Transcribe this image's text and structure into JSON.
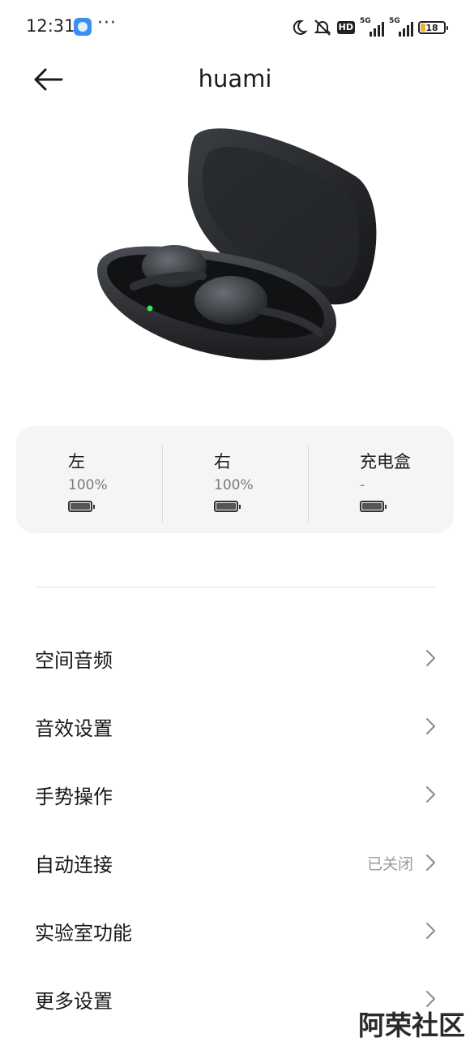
{
  "status_bar": {
    "time": "12:31",
    "more": "···",
    "hd_label": "HD",
    "network_1": "5G",
    "network_2": "5G",
    "battery_level": "18",
    "battery_color": "#f0b23a",
    "icons": [
      "app-icon",
      "moon-icon",
      "mute-bell-icon",
      "signal-icon",
      "battery-icon"
    ]
  },
  "header": {
    "title": "huami",
    "back_icon": "arrow-left-icon"
  },
  "product_image": "earbuds-charging-case",
  "battery_card": {
    "left": {
      "name": "左",
      "percent": "100%"
    },
    "right": {
      "name": "右",
      "percent": "100%"
    },
    "case": {
      "name": "充电盒",
      "percent": "-"
    }
  },
  "menu": {
    "items": [
      {
        "label": "空间音频",
        "value": ""
      },
      {
        "label": "音效设置",
        "value": ""
      },
      {
        "label": "手势操作",
        "value": ""
      },
      {
        "label": "自动连接",
        "value": "已关闭"
      },
      {
        "label": "实验室功能",
        "value": ""
      },
      {
        "label": "更多设置",
        "value": ""
      }
    ],
    "chevron_icon": "chevron-right-icon"
  },
  "watermark": "阿荣社区"
}
